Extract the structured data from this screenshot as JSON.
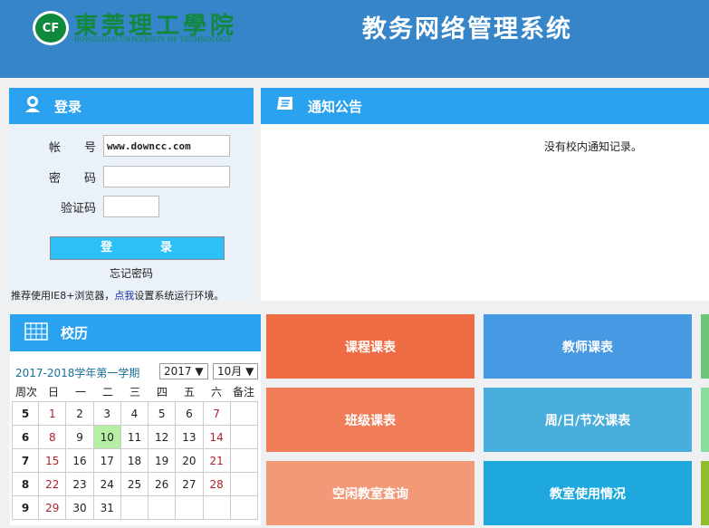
{
  "header": {
    "logo_mark": "CF",
    "school_cn": "東莞理工學院",
    "school_en": "DONGGUAN UNIVERSITY OF TECHNOLOGY",
    "system_title": "教务网络管理系统"
  },
  "login": {
    "title": "登录",
    "account_label": "帐　　号",
    "account_value": "www.downcc.com",
    "password_label": "密　　码",
    "captcha_label": "验证码",
    "login_button": "登　录",
    "forgot": "忘记密码",
    "tip_prefix": "推荐使用IE8+浏览器，",
    "tip_link": "点我",
    "tip_suffix": "设置系统运行环境。"
  },
  "notice": {
    "title": "通知公告",
    "message": "没有校内通知记录。"
  },
  "calendar": {
    "title": "校历",
    "term": "2017-2018学年第一学期",
    "year": "2017 ▼",
    "month": "10月 ▼",
    "headers": [
      "周次",
      "日",
      "一",
      "二",
      "三",
      "四",
      "五",
      "六",
      "备注"
    ],
    "rows": [
      [
        "5",
        "1",
        "2",
        "3",
        "4",
        "5",
        "6",
        "7",
        ""
      ],
      [
        "6",
        "8",
        "9",
        "10",
        "11",
        "12",
        "13",
        "14",
        ""
      ],
      [
        "7",
        "15",
        "16",
        "17",
        "18",
        "19",
        "20",
        "21",
        ""
      ],
      [
        "8",
        "22",
        "23",
        "24",
        "25",
        "26",
        "27",
        "28",
        ""
      ],
      [
        "9",
        "29",
        "30",
        "31",
        "",
        "",
        "",
        "",
        ""
      ]
    ],
    "today": "10"
  },
  "tiles": [
    {
      "label": "课程课表",
      "color": "#ee6c44"
    },
    {
      "label": "教师课表",
      "color": "#4799e3"
    },
    {
      "label": "",
      "color": "#6cc67a"
    },
    {
      "label": "班级课表",
      "color": "#f07c58"
    },
    {
      "label": "周/日/节次课表",
      "color": "#4aaedd"
    },
    {
      "label": "",
      "color": "#88dd9c"
    },
    {
      "label": "空闲教室查询",
      "color": "#f29a78"
    },
    {
      "label": "教室使用情况",
      "color": "#1ea8de"
    },
    {
      "label": "",
      "color": "#8fbe2a"
    }
  ]
}
